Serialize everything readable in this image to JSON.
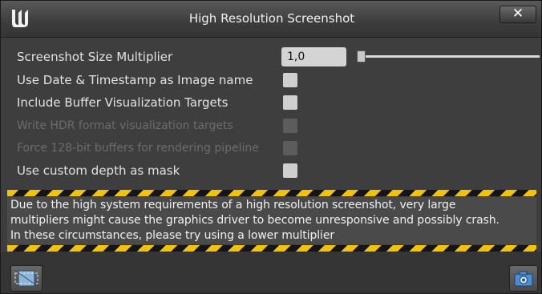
{
  "window": {
    "title": "High Resolution Screenshot",
    "close_label": "✕"
  },
  "options": {
    "size_multiplier": {
      "label": "Screenshot Size Multiplier",
      "value": "1,0",
      "slider_fraction": 0.0
    },
    "use_date_timestamp": {
      "label": "Use Date & Timestamp as Image name",
      "checked": false,
      "enabled": true
    },
    "include_buffer_targets": {
      "label": "Include Buffer Visualization Targets",
      "checked": false,
      "enabled": true
    },
    "write_hdr": {
      "label": "Write HDR format visualization targets",
      "checked": false,
      "enabled": false
    },
    "force_128bit": {
      "label": "Force 128-bit buffers for rendering pipeline",
      "checked": false,
      "enabled": false
    },
    "custom_depth_mask": {
      "label": "Use custom depth as mask",
      "checked": false,
      "enabled": true
    }
  },
  "warning": {
    "text": "Due to the high system requirements of a high resolution screenshot, very large\nmultipliers might cause the graphics driver to become unresponsive and possibly crash.\nIn these circumstances, please try using a lower multiplier"
  },
  "icons": {
    "logo": "unreal-engine-logo-icon",
    "region": "capture-region-icon",
    "capture": "camera-icon"
  },
  "colors": {
    "hazard_yellow": "#f3c200",
    "hazard_black": "#151515",
    "camera_blue": "#4a90d0"
  }
}
